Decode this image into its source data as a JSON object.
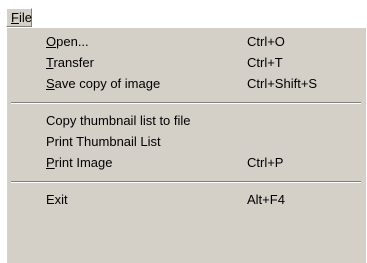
{
  "menubar": {
    "file": {
      "mnemonic": "F",
      "rest": "ile"
    }
  },
  "menu": {
    "open": {
      "mnemonic": "O",
      "rest": "pen...",
      "shortcut": "Ctrl+O"
    },
    "transfer": {
      "mnemonic": "T",
      "rest": "ransfer",
      "shortcut": "Ctrl+T"
    },
    "save_copy": {
      "mnemonic": "S",
      "rest": "ave copy of image",
      "shortcut": "Ctrl+Shift+S"
    },
    "copy_thumb": {
      "label": "Copy thumbnail list to file"
    },
    "print_thumb": {
      "label": "Print Thumbnail List"
    },
    "print_image": {
      "mnemonic": "P",
      "rest": "rint Image",
      "shortcut": "Ctrl+P"
    },
    "exit": {
      "label": "Exit",
      "shortcut": "Alt+F4"
    }
  },
  "colors": {
    "menu_background": "#d4d0c8",
    "highlight": "#ffffff",
    "shadow": "#808080"
  }
}
